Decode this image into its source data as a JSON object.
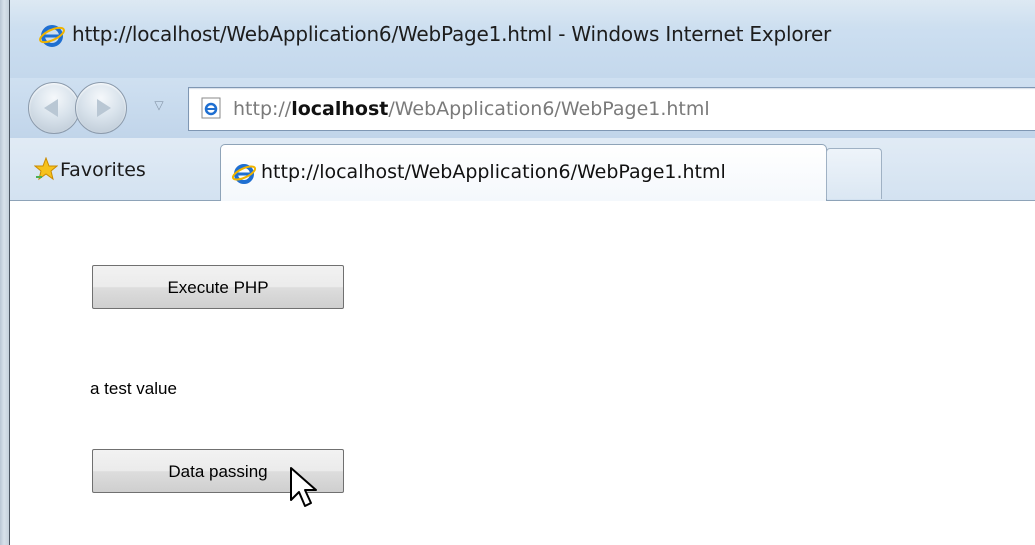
{
  "window": {
    "title": "http://localhost/WebApplication6/WebPage1.html - Windows Internet Explorer"
  },
  "address_bar": {
    "url_prefix": "http://",
    "url_host": "localhost",
    "url_path": "/WebApplication6/WebPage1.html"
  },
  "favorites_bar": {
    "favorites_label": "Favorites"
  },
  "tabs": [
    {
      "label": "http://localhost/WebApplication6/WebPage1.html",
      "active": true
    }
  ],
  "page": {
    "execute_button_label": "Execute PHP",
    "result_text": "a test value",
    "data_passing_button_label": "Data passing"
  },
  "icons": {
    "title": "ie-logo-icon",
    "back": "back-arrow-icon",
    "forward": "forward-arrow-icon",
    "recent": "chevron-down-icon",
    "address": "ie-page-icon",
    "favorites": "star-icon",
    "tab": "ie-logo-icon",
    "cursor": "mouse-cursor-icon"
  },
  "colors": {
    "chrome": "#c9dcef",
    "button_face": "#e6e6e6"
  }
}
